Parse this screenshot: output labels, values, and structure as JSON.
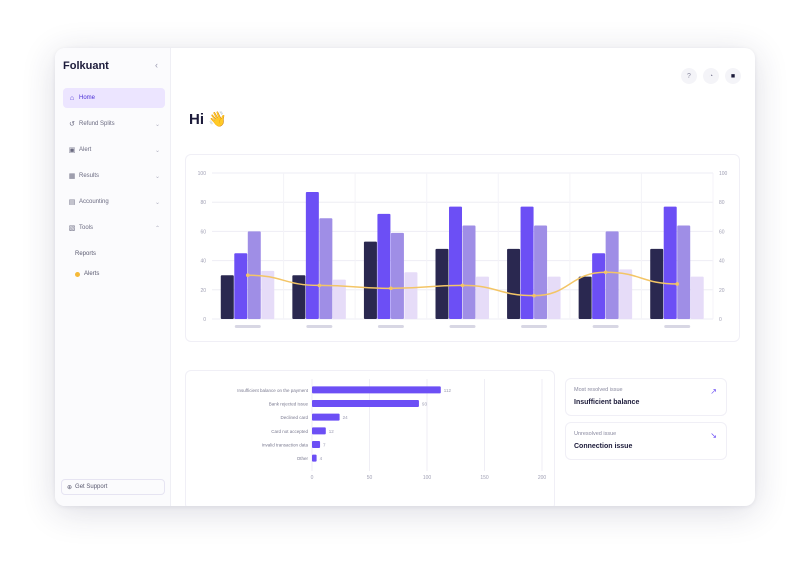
{
  "sidebar": {
    "brand": "Folkuant",
    "collapse_icon": "chevron-left-icon",
    "items": [
      {
        "label": "Home",
        "icon": "home-icon",
        "active": true
      },
      {
        "label": "Refund Splits",
        "icon": "refund-icon",
        "active": false
      },
      {
        "label": "Alert",
        "icon": "alert-icon",
        "active": false
      },
      {
        "label": "Results",
        "icon": "results-icon",
        "active": false
      },
      {
        "label": "Accounting",
        "icon": "accounting-icon",
        "active": false
      },
      {
        "label": "Tools",
        "icon": "tools-icon",
        "active": false
      }
    ],
    "subitems": [
      "Reports",
      "Alerts"
    ],
    "support": "Get Support"
  },
  "header": {
    "icons": [
      "help-icon",
      "notification-icon",
      "user-icon"
    ]
  },
  "greeting": {
    "text": "Hi",
    "emoji": "👋"
  },
  "colors": {
    "navy": "#2a2850",
    "violet": "#6c4ff5",
    "lavender": "#9f8ee6",
    "pale": "#e6dcf8",
    "line": "#f3c566"
  },
  "chart_data": [
    {
      "type": "bar",
      "categories": [
        "",
        "",
        "",
        "",
        "",
        "",
        ""
      ],
      "series": [
        {
          "values": [
            30,
            30,
            53,
            48,
            48,
            29,
            48
          ]
        },
        {
          "values": [
            45,
            87,
            72,
            77,
            77,
            45,
            77
          ]
        },
        {
          "values": [
            60,
            69,
            59,
            64,
            64,
            60,
            64
          ]
        },
        {
          "values": [
            33,
            27,
            32,
            29,
            29,
            34,
            29
          ]
        }
      ],
      "line": {
        "values": [
          30,
          23,
          21,
          23,
          16,
          32,
          24
        ]
      },
      "y_ticks": [
        "0",
        "20",
        "40",
        "60",
        "80",
        "100"
      ],
      "y_ticks_right": [
        "0",
        "20",
        "40",
        "60",
        "80",
        "100"
      ],
      "ylim": [
        0,
        100
      ],
      "grid": true
    },
    {
      "type": "bar",
      "orientation": "horizontal",
      "categories": [
        "Insufficient balance on the payment",
        "Bank rejected issue",
        "Declined card",
        "Card not accepted",
        "Invalid transaction data",
        "Other"
      ],
      "values": [
        112,
        93,
        24,
        12,
        7,
        4
      ],
      "x_ticks": [
        "0",
        "50",
        "100",
        "150",
        "200"
      ],
      "xlim": [
        0,
        200
      ],
      "grid": true
    }
  ],
  "issues": [
    {
      "label": "Most resolved issue",
      "value": "Insufficient balance",
      "icon": "trend-up-icon"
    },
    {
      "label": "Unresolved issue",
      "value": "Connection issue",
      "icon": "trend-down-icon"
    }
  ]
}
